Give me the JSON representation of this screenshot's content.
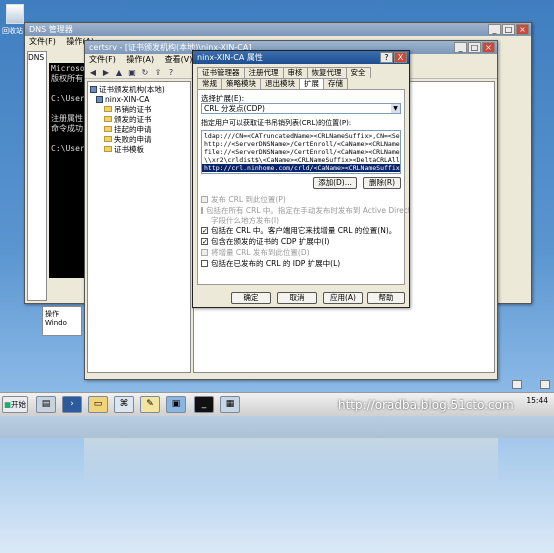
{
  "desktop": {
    "recycle_bin_label": "回收站",
    "icon_label": "Ｗｉｎ"
  },
  "dns_window": {
    "title": "DNS 管理器",
    "menu": [
      "文件(F)",
      "操作(A)"
    ],
    "tree_partial": [
      "DNS"
    ],
    "console_lines": [
      "Microsoft",
      "版权所有",
      "",
      "C:\\User",
      "",
      "注册属性",
      "命令成功",
      "",
      "C:\\User"
    ]
  },
  "certsrv_window": {
    "title": "certsrv - [证书颁发机构(本地)\\ninx-XIN-CA]",
    "menu": [
      "文件(F)",
      "操作(A)",
      "查看(V)",
      "帮"
    ],
    "tree": {
      "root": "证书颁发机构(本地)",
      "ca": "ninx-XIN-CA",
      "folders": [
        "吊销的证书",
        "颁发的证书",
        "挂起的申请",
        "失败的申请",
        "证书模板"
      ]
    },
    "behind_partial": [
      "操作",
      "Windo"
    ]
  },
  "dialog": {
    "title": "ninx-XIN-CA 属性",
    "help_btn": "?",
    "close_btn": "X",
    "tabs_row1": [
      "证书管理器",
      "注册代理",
      "审核",
      "恢复代理",
      "安全"
    ],
    "tabs_row2": [
      "常规",
      "策略模块",
      "退出模块",
      "扩展",
      "存储"
    ],
    "selected_tab": "扩展",
    "select_ext_label": "选择扩展(E):",
    "select_ext_value": "CRL 分发点(CDP)",
    "list_label": "指定用户可以获取证书吊销列表(CRL)的位置(P):",
    "list_items": [
      "ldap:///CN=<CATruncatedName><CRLNameSuffix>,CN=<ServerSh",
      "http://<ServerDNSName>/CertEnroll/<CaName><CRLNameSuffix",
      "file://<ServerDNSName>/CertEnroll/<CaName><CRLNameSuffix",
      "\\\\xr2\\crldist$\\<CaName><CRLNameSuffix><DeltaCRLAllowed>",
      "http://crl.ninhome.com/crld/<CaName><CRLNameSuffix><Delt"
    ],
    "selected_item_index": 4,
    "add_btn": "添加(D)...",
    "remove_btn": "删除(R)",
    "options": [
      {
        "label": "发布 CRL 到此位置(P)",
        "checked": false,
        "enabled": false
      },
      {
        "label": "包括在所有 CRL 中。指定在手动发布时发布到 Active Directory",
        "checked": false,
        "enabled": false
      },
      {
        "label": "字段什么地方发布(I)",
        "checked": false,
        "enabled": false,
        "continuation": true
      },
      {
        "label": "包括在 CRL 中。客户端用它来找增量 CRL 的位置(N)。",
        "checked": true,
        "enabled": true
      },
      {
        "label": "包含在颁发的证书的 CDP 扩展中(I)",
        "checked": true,
        "enabled": true
      },
      {
        "label": "将增量 CRL 发布到此位置(D)",
        "checked": false,
        "enabled": false
      },
      {
        "label": "包括在已发布的 CRL 的 IDP 扩展中(L)",
        "checked": false,
        "enabled": true
      }
    ],
    "buttons": [
      "确定",
      "取消",
      "应用(A)",
      "帮助"
    ]
  },
  "taskbar": {
    "start_label": "开始",
    "time": "15:44",
    "icons": [
      "server-manager-icon",
      "powershell-icon",
      "explorer-icon",
      "network-icon",
      "certificate-icon",
      "remote-desktop-icon",
      "cmd-icon",
      "certsrv-icon"
    ]
  },
  "watermark": "http://oradba.blog.51cto.com",
  "colors": {
    "title_active": "#1f4f8f",
    "selection": "#0a246a",
    "desktop": "#4a88c8"
  }
}
